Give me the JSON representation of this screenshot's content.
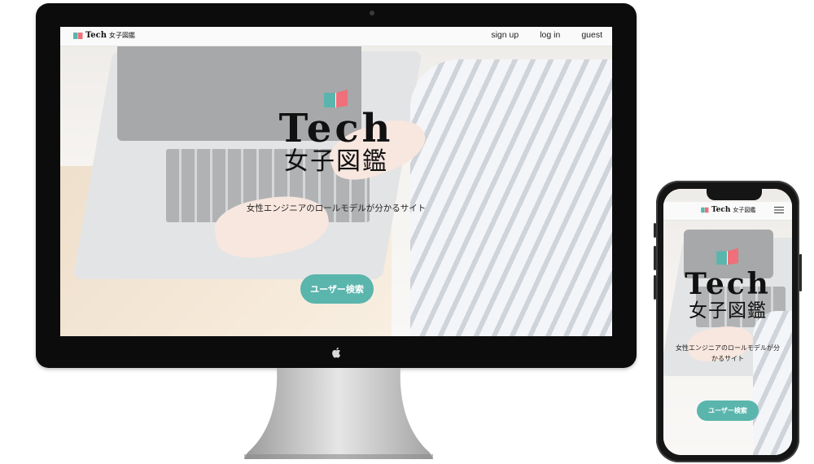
{
  "site": {
    "logo_text": "Tech",
    "logo_subtext": "女子図鑑",
    "hero_title": "Tech",
    "hero_subtitle": "女子図鑑",
    "tagline": "女性エンジニアのロールモデルが分かるサイト",
    "search_button_label": "ユーザー検索",
    "nav": {
      "signup_label": "sign up",
      "login_label": "log in",
      "guest_label": "guest"
    }
  },
  "mobile": {
    "logo_text": "Tech",
    "logo_subtext": "女子図鑑",
    "hero_title": "Tech",
    "hero_subtitle": "女子図鑑",
    "tagline": "女性エンジニアのロールモデルが分かるサイト",
    "search_button_label": "ユーザー検索",
    "menu_icon": "hamburger-menu-icon"
  },
  "colors": {
    "accent_teal": "#5ab5ad",
    "emblem_pink": "#ef6f7a",
    "emblem_teal": "#5ab5ad",
    "device_bezel": "#0c0c0c"
  }
}
